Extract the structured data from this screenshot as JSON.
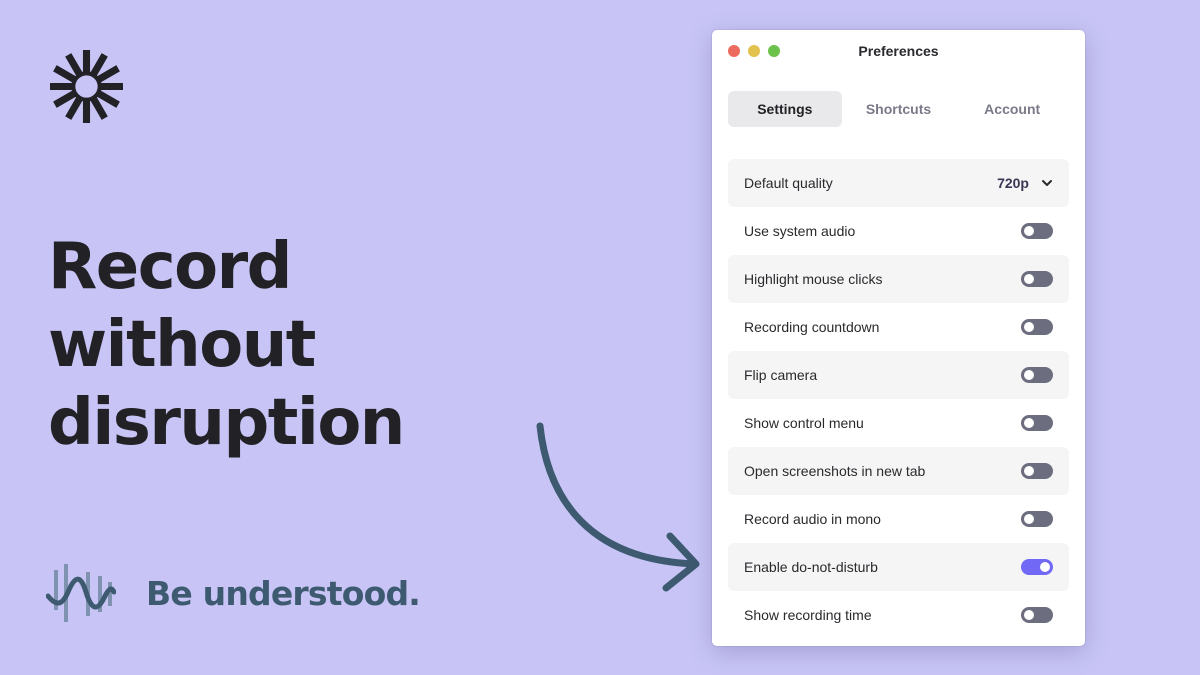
{
  "hero": {
    "headline": [
      "Record",
      "without",
      "disruption"
    ],
    "tagline": "Be understood."
  },
  "window": {
    "title": "Preferences",
    "traffic_lights": [
      "close",
      "minimize",
      "maximize"
    ],
    "tabs": [
      {
        "label": "Settings",
        "active": true
      },
      {
        "label": "Shortcuts",
        "active": false
      },
      {
        "label": "Account",
        "active": false
      }
    ],
    "quality": {
      "label": "Default quality",
      "value": "720p"
    },
    "settings": [
      {
        "label": "Use system audio",
        "on": false
      },
      {
        "label": "Highlight mouse clicks",
        "on": false
      },
      {
        "label": "Recording countdown",
        "on": false
      },
      {
        "label": "Flip camera",
        "on": false
      },
      {
        "label": "Show control menu",
        "on": false
      },
      {
        "label": "Open screenshots in new tab",
        "on": false
      },
      {
        "label": "Record audio in mono",
        "on": false
      },
      {
        "label": "Enable do-not-disturb",
        "on": true
      },
      {
        "label": "Show recording time",
        "on": false
      }
    ]
  },
  "colors": {
    "background": "#c8c5f6",
    "toggle_on": "#7168f5",
    "toggle_off": "#6d6d80",
    "accent_text": "#3d5a70"
  }
}
